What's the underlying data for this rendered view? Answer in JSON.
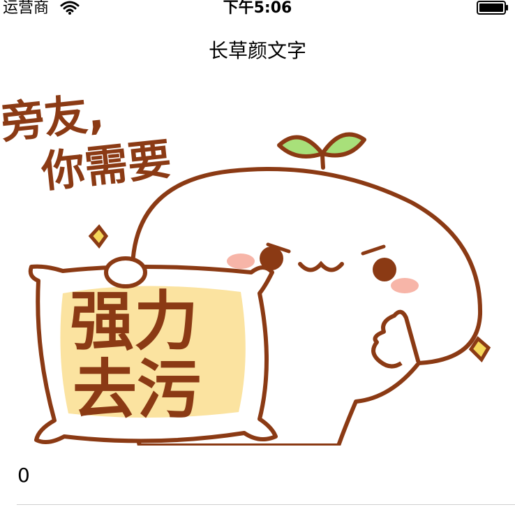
{
  "status_bar": {
    "carrier": "运营商",
    "time": "下午5:06",
    "wifi_icon": "wifi-icon",
    "battery_icon": "battery-icon"
  },
  "nav": {
    "title": "长草颜文字"
  },
  "meme": {
    "caption_line1": "旁友,",
    "caption_line2": "你需要",
    "pillow_line1": "强力",
    "pillow_line2": "去污"
  },
  "counter": {
    "value": "0"
  },
  "colors": {
    "outline": "#8B3A14",
    "pillow_fill": "#FBE3A0",
    "sprout": "#A8E07A",
    "cheek": "#F7B5A8",
    "sparkle": "#F5D75A"
  }
}
